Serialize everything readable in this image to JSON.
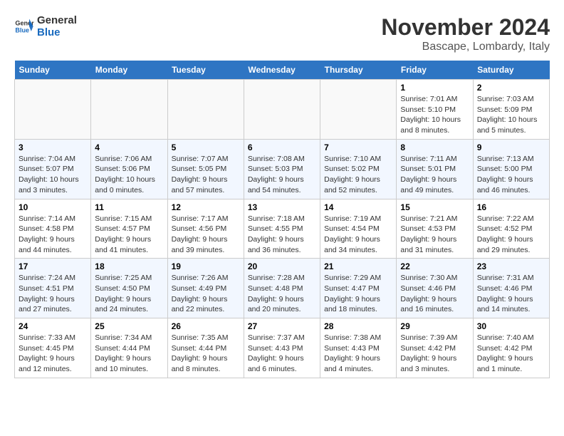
{
  "header": {
    "logo_line1": "General",
    "logo_line2": "Blue",
    "title": "November 2024",
    "subtitle": "Bascape, Lombardy, Italy"
  },
  "weekdays": [
    "Sunday",
    "Monday",
    "Tuesday",
    "Wednesday",
    "Thursday",
    "Friday",
    "Saturday"
  ],
  "weeks": [
    [
      {
        "day": "",
        "info": ""
      },
      {
        "day": "",
        "info": ""
      },
      {
        "day": "",
        "info": ""
      },
      {
        "day": "",
        "info": ""
      },
      {
        "day": "",
        "info": ""
      },
      {
        "day": "1",
        "info": "Sunrise: 7:01 AM\nSunset: 5:10 PM\nDaylight: 10 hours and 8 minutes."
      },
      {
        "day": "2",
        "info": "Sunrise: 7:03 AM\nSunset: 5:09 PM\nDaylight: 10 hours and 5 minutes."
      }
    ],
    [
      {
        "day": "3",
        "info": "Sunrise: 7:04 AM\nSunset: 5:07 PM\nDaylight: 10 hours and 3 minutes."
      },
      {
        "day": "4",
        "info": "Sunrise: 7:06 AM\nSunset: 5:06 PM\nDaylight: 10 hours and 0 minutes."
      },
      {
        "day": "5",
        "info": "Sunrise: 7:07 AM\nSunset: 5:05 PM\nDaylight: 9 hours and 57 minutes."
      },
      {
        "day": "6",
        "info": "Sunrise: 7:08 AM\nSunset: 5:03 PM\nDaylight: 9 hours and 54 minutes."
      },
      {
        "day": "7",
        "info": "Sunrise: 7:10 AM\nSunset: 5:02 PM\nDaylight: 9 hours and 52 minutes."
      },
      {
        "day": "8",
        "info": "Sunrise: 7:11 AM\nSunset: 5:01 PM\nDaylight: 9 hours and 49 minutes."
      },
      {
        "day": "9",
        "info": "Sunrise: 7:13 AM\nSunset: 5:00 PM\nDaylight: 9 hours and 46 minutes."
      }
    ],
    [
      {
        "day": "10",
        "info": "Sunrise: 7:14 AM\nSunset: 4:58 PM\nDaylight: 9 hours and 44 minutes."
      },
      {
        "day": "11",
        "info": "Sunrise: 7:15 AM\nSunset: 4:57 PM\nDaylight: 9 hours and 41 minutes."
      },
      {
        "day": "12",
        "info": "Sunrise: 7:17 AM\nSunset: 4:56 PM\nDaylight: 9 hours and 39 minutes."
      },
      {
        "day": "13",
        "info": "Sunrise: 7:18 AM\nSunset: 4:55 PM\nDaylight: 9 hours and 36 minutes."
      },
      {
        "day": "14",
        "info": "Sunrise: 7:19 AM\nSunset: 4:54 PM\nDaylight: 9 hours and 34 minutes."
      },
      {
        "day": "15",
        "info": "Sunrise: 7:21 AM\nSunset: 4:53 PM\nDaylight: 9 hours and 31 minutes."
      },
      {
        "day": "16",
        "info": "Sunrise: 7:22 AM\nSunset: 4:52 PM\nDaylight: 9 hours and 29 minutes."
      }
    ],
    [
      {
        "day": "17",
        "info": "Sunrise: 7:24 AM\nSunset: 4:51 PM\nDaylight: 9 hours and 27 minutes."
      },
      {
        "day": "18",
        "info": "Sunrise: 7:25 AM\nSunset: 4:50 PM\nDaylight: 9 hours and 24 minutes."
      },
      {
        "day": "19",
        "info": "Sunrise: 7:26 AM\nSunset: 4:49 PM\nDaylight: 9 hours and 22 minutes."
      },
      {
        "day": "20",
        "info": "Sunrise: 7:28 AM\nSunset: 4:48 PM\nDaylight: 9 hours and 20 minutes."
      },
      {
        "day": "21",
        "info": "Sunrise: 7:29 AM\nSunset: 4:47 PM\nDaylight: 9 hours and 18 minutes."
      },
      {
        "day": "22",
        "info": "Sunrise: 7:30 AM\nSunset: 4:46 PM\nDaylight: 9 hours and 16 minutes."
      },
      {
        "day": "23",
        "info": "Sunrise: 7:31 AM\nSunset: 4:46 PM\nDaylight: 9 hours and 14 minutes."
      }
    ],
    [
      {
        "day": "24",
        "info": "Sunrise: 7:33 AM\nSunset: 4:45 PM\nDaylight: 9 hours and 12 minutes."
      },
      {
        "day": "25",
        "info": "Sunrise: 7:34 AM\nSunset: 4:44 PM\nDaylight: 9 hours and 10 minutes."
      },
      {
        "day": "26",
        "info": "Sunrise: 7:35 AM\nSunset: 4:44 PM\nDaylight: 9 hours and 8 minutes."
      },
      {
        "day": "27",
        "info": "Sunrise: 7:37 AM\nSunset: 4:43 PM\nDaylight: 9 hours and 6 minutes."
      },
      {
        "day": "28",
        "info": "Sunrise: 7:38 AM\nSunset: 4:43 PM\nDaylight: 9 hours and 4 minutes."
      },
      {
        "day": "29",
        "info": "Sunrise: 7:39 AM\nSunset: 4:42 PM\nDaylight: 9 hours and 3 minutes."
      },
      {
        "day": "30",
        "info": "Sunrise: 7:40 AM\nSunset: 4:42 PM\nDaylight: 9 hours and 1 minute."
      }
    ]
  ]
}
